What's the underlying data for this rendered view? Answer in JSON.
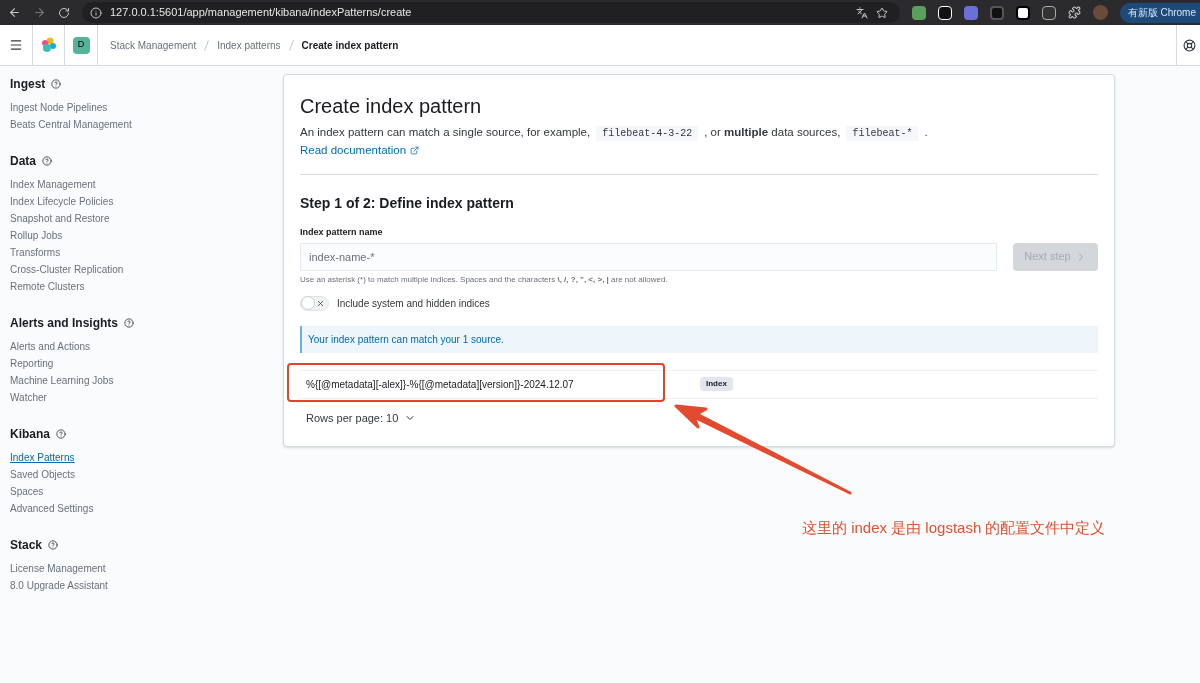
{
  "browser": {
    "url": "127.0.0.1:5601/app/management/kibana/indexPatterns/create",
    "update_button": "有新版 Chrome"
  },
  "header": {
    "space_badge": "D",
    "breadcrumbs": [
      {
        "label": "Stack Management",
        "current": false
      },
      {
        "label": "Index patterns",
        "current": false
      },
      {
        "label": "Create index pattern",
        "current": true
      }
    ]
  },
  "sidebar": {
    "sections": [
      {
        "title": "Ingest",
        "items": [
          {
            "label": "Ingest Node Pipelines",
            "selected": false
          },
          {
            "label": "Beats Central Management",
            "selected": false
          }
        ]
      },
      {
        "title": "Data",
        "items": [
          {
            "label": "Index Management",
            "selected": false
          },
          {
            "label": "Index Lifecycle Policies",
            "selected": false
          },
          {
            "label": "Snapshot and Restore",
            "selected": false
          },
          {
            "label": "Rollup Jobs",
            "selected": false
          },
          {
            "label": "Transforms",
            "selected": false
          },
          {
            "label": "Cross-Cluster Replication",
            "selected": false
          },
          {
            "label": "Remote Clusters",
            "selected": false
          }
        ]
      },
      {
        "title": "Alerts and Insights",
        "items": [
          {
            "label": "Alerts and Actions",
            "selected": false
          },
          {
            "label": "Reporting",
            "selected": false
          },
          {
            "label": "Machine Learning Jobs",
            "selected": false
          },
          {
            "label": "Watcher",
            "selected": false
          }
        ]
      },
      {
        "title": "Kibana",
        "items": [
          {
            "label": "Index Patterns",
            "selected": true
          },
          {
            "label": "Saved Objects",
            "selected": false
          },
          {
            "label": "Spaces",
            "selected": false
          },
          {
            "label": "Advanced Settings",
            "selected": false
          }
        ]
      },
      {
        "title": "Stack",
        "items": [
          {
            "label": "License Management",
            "selected": false
          },
          {
            "label": "8.0 Upgrade Assistant",
            "selected": false
          }
        ]
      }
    ]
  },
  "page": {
    "title": "Create index pattern",
    "description": [
      {
        "kind": "text",
        "text": "An index pattern can match a single source, for example,"
      },
      {
        "kind": "code",
        "text": "filebeat-4-3-22"
      },
      {
        "kind": "text",
        "text": ", or **multiple** data sources,"
      },
      {
        "kind": "code",
        "text": "filebeat-*"
      },
      {
        "kind": "text",
        "text": "."
      }
    ],
    "doc_link": "Read documentation",
    "step_title": "Step 1 of 2: Define index pattern",
    "field": {
      "label": "Index pattern name",
      "placeholder": "index-name-*"
    },
    "next_button": {
      "label": "Next step",
      "disabled": true
    },
    "help_text": "Use an asterisk (*) to match multiple indices. Spaces and the characters **\\, /, ?, \", <, >, |** are not allowed.",
    "toggle": {
      "label": "Include system and hidden indices",
      "on": false
    },
    "callout": "Your index pattern can match your 1 source.",
    "table": {
      "rows": [
        {
          "name": "%{[@metadata][-alex]}-%{[@metadata][version]}-2024.12.07",
          "tag": "Index"
        }
      ]
    },
    "pagination": "Rows per page: 10"
  },
  "annotation": {
    "text": "这里的 index 是由 logstash 的配置文件中定义"
  }
}
